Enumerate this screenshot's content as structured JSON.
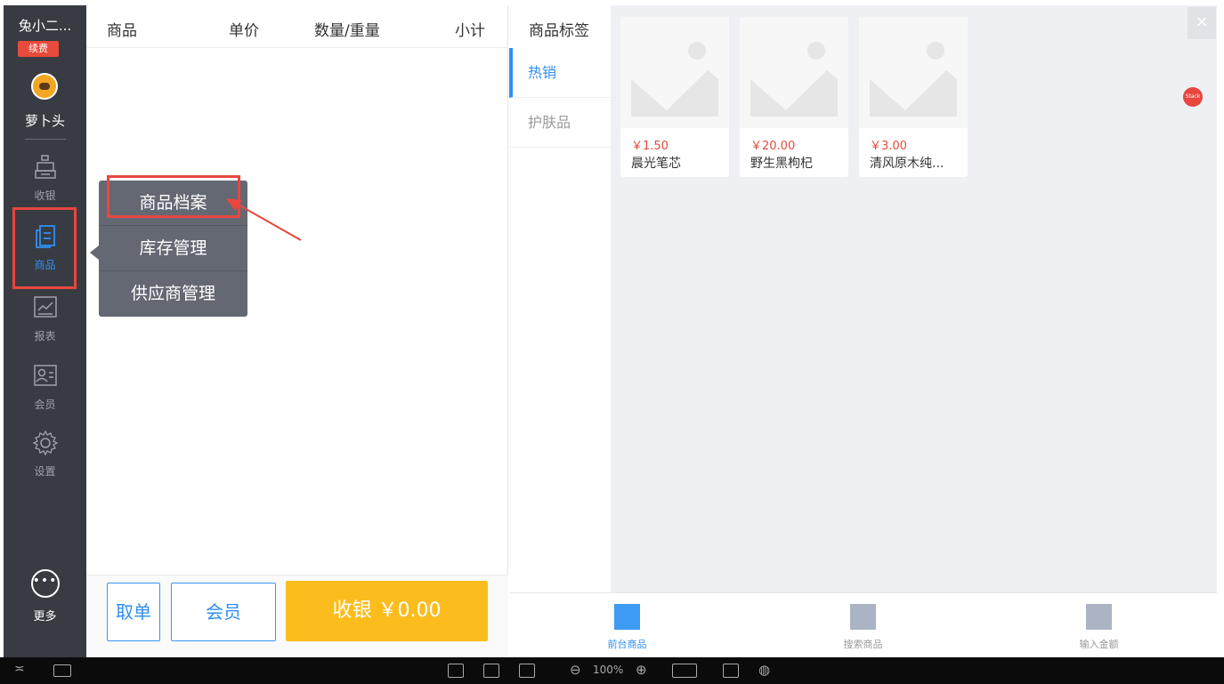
{
  "sidebar": {
    "shop_name": "兔小二...",
    "renew_label": "续费",
    "username": "萝卜头",
    "items": [
      {
        "label": "收银",
        "icon": "register-icon"
      },
      {
        "label": "商品",
        "icon": "product-doc-icon"
      },
      {
        "label": "报表",
        "icon": "report-chart-icon"
      },
      {
        "label": "会员",
        "icon": "member-card-icon"
      },
      {
        "label": "设置",
        "icon": "settings-gear-icon"
      }
    ],
    "more_label": "更多"
  },
  "order": {
    "columns": [
      "商品",
      "单价",
      "数量/重量",
      "小计"
    ],
    "cancel_label": "取单",
    "member_label": "会员",
    "checkout_label": "收银 ￥0.00"
  },
  "menu": {
    "items": [
      "商品档案",
      "库存管理",
      "供应商管理"
    ]
  },
  "categories": {
    "title": "商品标签",
    "items": [
      "热销",
      "护肤品"
    ]
  },
  "products": [
    {
      "price": "￥1.50",
      "name": "晨光笔芯"
    },
    {
      "price": "￥20.00",
      "name": "野生黑枸杞"
    },
    {
      "price": "￥3.00",
      "name": "清风原木纯..."
    }
  ],
  "stack_label": "Stack",
  "close_label": "×",
  "tabs": [
    {
      "label": "前台商品"
    },
    {
      "label": "搜索商品"
    },
    {
      "label": "输入金额"
    }
  ],
  "sysbar": {
    "zoom": "100%"
  },
  "colors": {
    "accent": "#2f8ff2",
    "pay": "#fbbc1d",
    "highlight": "#e8463f",
    "sidebar": "#383b42"
  }
}
